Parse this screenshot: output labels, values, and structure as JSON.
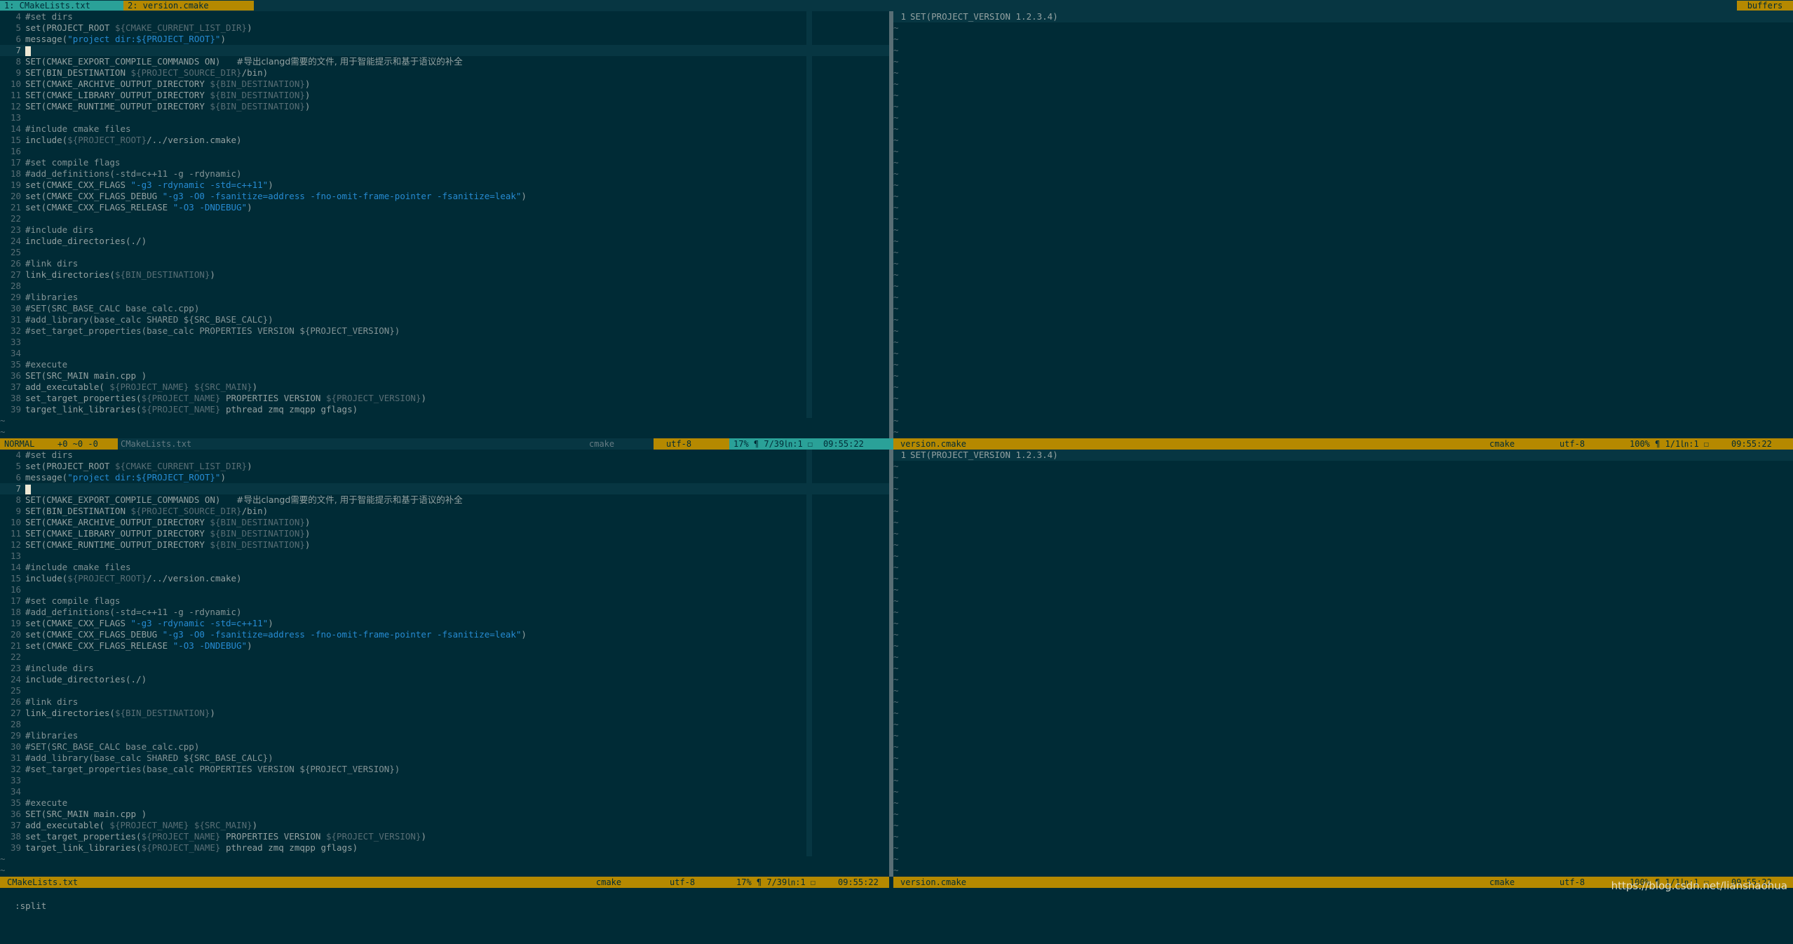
{
  "tabline": {
    "tabs": [
      {
        "label": "1: CMakeLists.txt",
        "active": true
      },
      {
        "label": "2: version.cmake",
        "active": false
      }
    ],
    "buffers_label": "buffers"
  },
  "cmake_lines": [
    {
      "n": "4",
      "parts": [
        [
          "c-comment",
          "#set dirs"
        ]
      ]
    },
    {
      "n": "5",
      "parts": [
        [
          "c-text",
          "set(PROJECT_ROOT "
        ],
        [
          "c-var",
          "${CMAKE_CURRENT_LIST_DIR}"
        ],
        [
          "c-text",
          ")"
        ]
      ]
    },
    {
      "n": "6",
      "parts": [
        [
          "c-text",
          "message("
        ],
        [
          "c-str",
          "\"project dir:${PROJECT_ROOT}\""
        ],
        [
          "c-text",
          ")"
        ]
      ]
    },
    {
      "n": "7",
      "parts": [],
      "cursor": true
    },
    {
      "n": "8",
      "parts": [
        [
          "c-text",
          "SET(CMAKE_EXPORT_COMPILE_COMMANDS ON)   "
        ],
        [
          "c-cjk",
          "#导出clangd需要的文件, 用于智能提示和基于语议的补全"
        ]
      ]
    },
    {
      "n": "9",
      "parts": [
        [
          "c-text",
          "SET(BIN_DESTINATION "
        ],
        [
          "c-var",
          "${PROJECT_SOURCE_DIR}"
        ],
        [
          "c-text",
          "/bin)"
        ]
      ]
    },
    {
      "n": "10",
      "parts": [
        [
          "c-text",
          "SET(CMAKE_ARCHIVE_OUTPUT_DIRECTORY "
        ],
        [
          "c-var",
          "${BIN_DESTINATION}"
        ],
        [
          "c-text",
          ")"
        ]
      ]
    },
    {
      "n": "11",
      "parts": [
        [
          "c-text",
          "SET(CMAKE_LIBRARY_OUTPUT_DIRECTORY "
        ],
        [
          "c-var",
          "${BIN_DESTINATION}"
        ],
        [
          "c-text",
          ")"
        ]
      ]
    },
    {
      "n": "12",
      "parts": [
        [
          "c-text",
          "SET(CMAKE_RUNTIME_OUTPUT_DIRECTORY "
        ],
        [
          "c-var",
          "${BIN_DESTINATION}"
        ],
        [
          "c-text",
          ")"
        ]
      ]
    },
    {
      "n": "13",
      "parts": []
    },
    {
      "n": "14",
      "parts": [
        [
          "c-comment",
          "#include cmake files"
        ]
      ]
    },
    {
      "n": "15",
      "parts": [
        [
          "c-text",
          "include("
        ],
        [
          "c-var",
          "${PROJECT_ROOT}"
        ],
        [
          "c-text",
          "/../version.cmake)"
        ]
      ]
    },
    {
      "n": "16",
      "parts": []
    },
    {
      "n": "17",
      "parts": [
        [
          "c-comment",
          "#set compile flags"
        ]
      ]
    },
    {
      "n": "18",
      "parts": [
        [
          "c-comment",
          "#add_definitions(-std=c++11 -g -rdynamic)"
        ]
      ]
    },
    {
      "n": "19",
      "parts": [
        [
          "c-text",
          "set(CMAKE_CXX_FLAGS "
        ],
        [
          "c-str",
          "\"-g3 -rdynamic -std=c++11\""
        ],
        [
          "c-text",
          ")"
        ]
      ]
    },
    {
      "n": "20",
      "parts": [
        [
          "c-text",
          "set(CMAKE_CXX_FLAGS_DEBUG "
        ],
        [
          "c-str",
          "\"-g3 -O0 -fsanitize=address -fno-omit-frame-pointer -fsanitize=leak\""
        ],
        [
          "c-text",
          ")"
        ]
      ]
    },
    {
      "n": "21",
      "parts": [
        [
          "c-text",
          "set(CMAKE_CXX_FLAGS_RELEASE "
        ],
        [
          "c-str",
          "\"-O3 -DNDEBUG\""
        ],
        [
          "c-text",
          ")"
        ]
      ]
    },
    {
      "n": "22",
      "parts": []
    },
    {
      "n": "23",
      "parts": [
        [
          "c-comment",
          "#include dirs"
        ]
      ]
    },
    {
      "n": "24",
      "parts": [
        [
          "c-text",
          "include_directories(./)"
        ]
      ]
    },
    {
      "n": "25",
      "parts": []
    },
    {
      "n": "26",
      "parts": [
        [
          "c-comment",
          "#link dirs"
        ]
      ]
    },
    {
      "n": "27",
      "parts": [
        [
          "c-text",
          "link_directories("
        ],
        [
          "c-var",
          "${BIN_DESTINATION}"
        ],
        [
          "c-text",
          ")"
        ]
      ]
    },
    {
      "n": "28",
      "parts": []
    },
    {
      "n": "29",
      "parts": [
        [
          "c-comment",
          "#libraries"
        ]
      ]
    },
    {
      "n": "30",
      "parts": [
        [
          "c-comment",
          "#SET(SRC_BASE_CALC base_calc.cpp)"
        ]
      ]
    },
    {
      "n": "31",
      "parts": [
        [
          "c-comment",
          "#add_library(base_calc SHARED ${SRC_BASE_CALC})"
        ]
      ]
    },
    {
      "n": "32",
      "parts": [
        [
          "c-comment",
          "#set_target_properties(base_calc PROPERTIES VERSION ${PROJECT_VERSION})"
        ]
      ]
    },
    {
      "n": "33",
      "parts": []
    },
    {
      "n": "34",
      "parts": []
    },
    {
      "n": "35",
      "parts": [
        [
          "c-comment",
          "#execute"
        ]
      ]
    },
    {
      "n": "36",
      "parts": [
        [
          "c-text",
          "SET(SRC_MAIN main.cpp )"
        ]
      ]
    },
    {
      "n": "37",
      "parts": [
        [
          "c-text",
          "add_executable( "
        ],
        [
          "c-var",
          "${PROJECT_NAME}"
        ],
        [
          "c-text",
          " "
        ],
        [
          "c-var",
          "${SRC_MAIN}"
        ],
        [
          "c-text",
          ")"
        ]
      ]
    },
    {
      "n": "38",
      "parts": [
        [
          "c-text",
          "set_target_properties("
        ],
        [
          "c-var",
          "${PROJECT_NAME}"
        ],
        [
          "c-text",
          " PROPERTIES VERSION "
        ],
        [
          "c-var",
          "${PROJECT_VERSION}"
        ],
        [
          "c-text",
          ")"
        ]
      ]
    },
    {
      "n": "39",
      "parts": [
        [
          "c-text",
          "target_link_libraries("
        ],
        [
          "c-var",
          "${PROJECT_NAME}"
        ],
        [
          "c-text",
          " pthread zmq zmqpp gflags)"
        ]
      ]
    }
  ],
  "version_lines": [
    {
      "n": "1",
      "text": "SET(PROJECT_VERSION 1.2.3.4)"
    }
  ],
  "status_top_left": {
    "mode": "NORMAL",
    "git": "+0 ~0 -0",
    "filename": "CMakeLists.txt",
    "filetype": "cmake",
    "encoding": "utf-8",
    "position": "17% ¶ 7/39㏑:1 ☐",
    "time": "09:55:22"
  },
  "status_top_right": {
    "filename": "version.cmake",
    "filetype": "cmake",
    "encoding": "utf-8",
    "position": "100% ¶ 1/1㏑:1 ☐",
    "time": "09:55:22"
  },
  "status_bottom_left": {
    "filename": "CMakeLists.txt",
    "filetype": "cmake",
    "encoding": "utf-8",
    "position": "17% ¶ 7/39㏑:1 ☐",
    "time": "09:55:22"
  },
  "status_bottom_right": {
    "filename": "version.cmake",
    "filetype": "cmake",
    "encoding": "utf-8",
    "position": "100% ¶ 1/1㏑:1 ☐",
    "time": "09:55:22"
  },
  "cmdline": ":split",
  "watermark": "https://blog.csdn.net/lianshaohua"
}
